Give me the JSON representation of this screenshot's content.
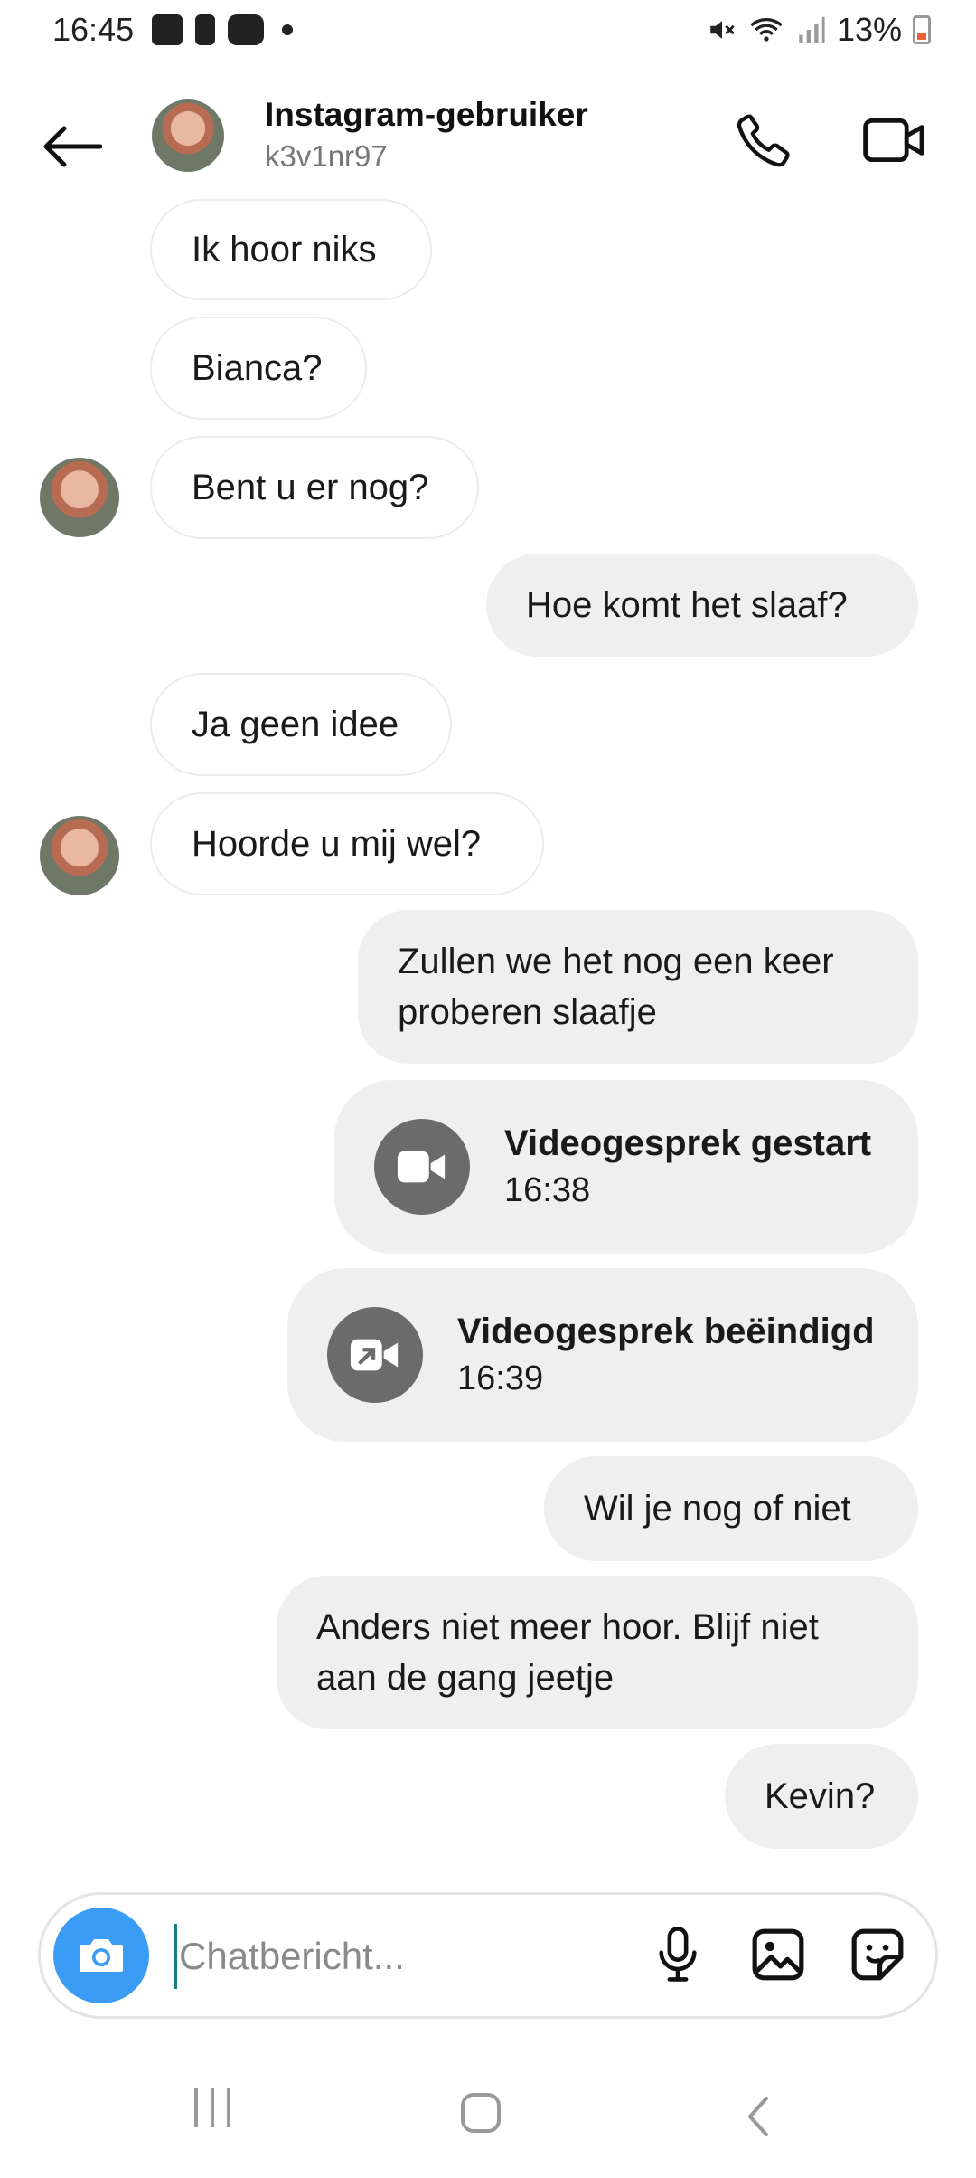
{
  "status": {
    "time": "16:45",
    "battery": "13%"
  },
  "header": {
    "name": "Instagram-gebruiker",
    "username": "k3v1nr97"
  },
  "messages": {
    "m1": "Ik hoor niks",
    "m2": "Bianca?",
    "m3": "Bent u er nog?",
    "m4": "Hoe komt het slaaf?",
    "m5": "Ja geen idee",
    "m6": "Hoorde u mij wel?",
    "m7_line1": "Zullen we het nog een keer",
    "m7_line2": "proberen slaafje",
    "call1_title": "Videogesprek gestart",
    "call1_time": "16:38",
    "call2_title": "Videogesprek beëindigd",
    "call2_time": "16:39",
    "m8": "Wil je nog of niet",
    "m9_line1": "Anders niet meer hoor. Blijf niet",
    "m9_line2": "aan de gang jeetje",
    "m10": "Kevin?"
  },
  "composer": {
    "placeholder": "Chatbericht..."
  },
  "icons": {
    "back": "arrow-left-icon",
    "phone": "phone-icon",
    "video": "video-camera-icon",
    "camera": "camera-icon",
    "mic": "microphone-icon",
    "gallery": "image-icon",
    "sticker": "sticker-icon"
  },
  "colors": {
    "camera_button": "#3a9cf5",
    "outgoing_bubble": "#efefef",
    "call_icon_bg": "#6b6b6b"
  }
}
